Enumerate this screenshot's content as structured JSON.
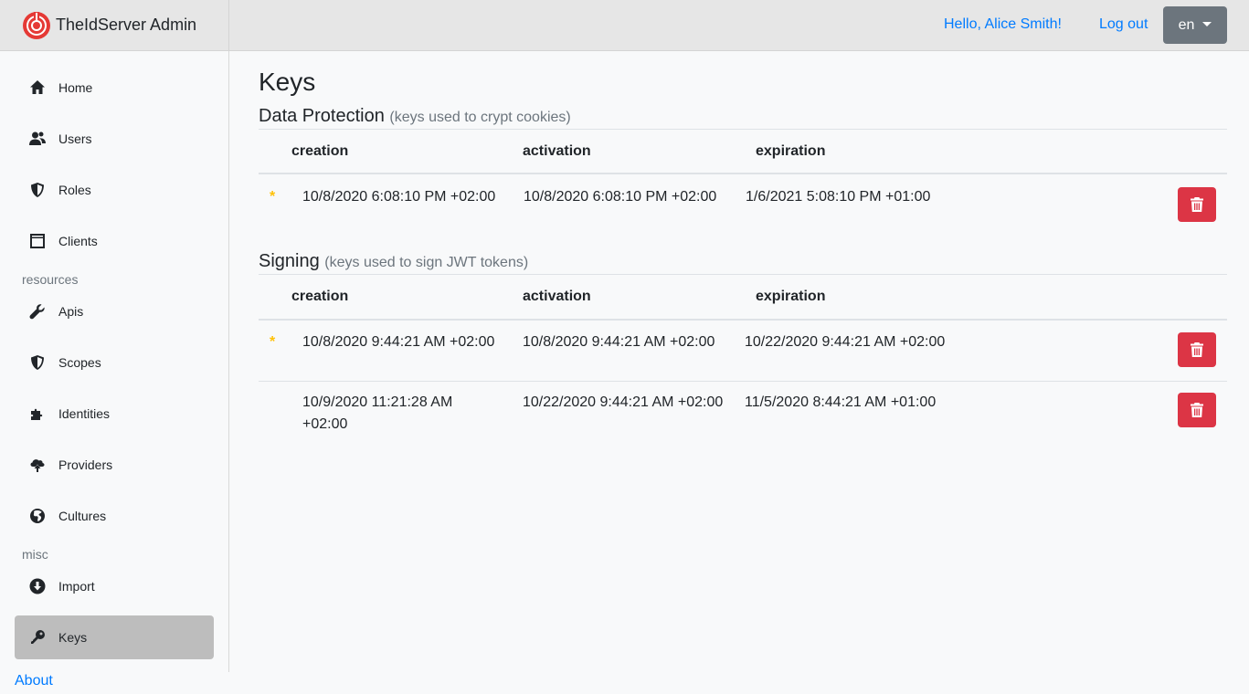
{
  "app": {
    "title": "TheIdServer Admin"
  },
  "header": {
    "greeting": "Hello, Alice Smith!",
    "logout": "Log out",
    "language": "en"
  },
  "sidebar": {
    "items": [
      {
        "label": "Home",
        "icon": "home-icon"
      },
      {
        "label": "Users",
        "icon": "users-icon"
      },
      {
        "label": "Roles",
        "icon": "shield-icon"
      },
      {
        "label": "Clients",
        "icon": "window-icon"
      }
    ],
    "section_resources": "resources",
    "resources": [
      {
        "label": "Apis",
        "icon": "wrench-icon"
      },
      {
        "label": "Scopes",
        "icon": "shield-icon"
      },
      {
        "label": "Identities",
        "icon": "puzzle-icon"
      },
      {
        "label": "Providers",
        "icon": "cloud-upload-icon"
      },
      {
        "label": "Cultures",
        "icon": "globe-icon"
      }
    ],
    "section_misc": "misc",
    "misc": [
      {
        "label": "Import",
        "icon": "download-icon"
      },
      {
        "label": "Keys",
        "icon": "key-icon",
        "active": true
      }
    ],
    "about": "About"
  },
  "main": {
    "title": "Keys",
    "columns": {
      "creation": "creation",
      "activation": "activation",
      "expiration": "expiration"
    },
    "data_protection": {
      "title": "Data Protection",
      "subtitle": "(keys used to crypt cookies)",
      "rows": [
        {
          "current": "*",
          "creation": "10/8/2020 6:08:10 PM +02:00",
          "activation": "10/8/2020 6:08:10 PM +02:00",
          "expiration": "1/6/2021 5:08:10 PM +01:00"
        }
      ]
    },
    "signing": {
      "title": "Signing",
      "subtitle": "(keys used to sign JWT tokens)",
      "rows": [
        {
          "current": "*",
          "creation": "10/8/2020 9:44:21 AM +02:00",
          "activation": "10/8/2020 9:44:21 AM +02:00",
          "expiration": "10/22/2020 9:44:21 AM +02:00"
        },
        {
          "current": "",
          "creation_line1": "10/9/2020 11:21:28 AM",
          "creation_line2": "+02:00",
          "activation": "10/22/2020 9:44:21 AM +02:00",
          "expiration": "11/5/2020 8:44:21 AM +01:00"
        }
      ]
    }
  },
  "colors": {
    "accent": "#007bff",
    "danger": "#dc3545",
    "star": "#ffc107",
    "active_nav": "#bdbdbd"
  }
}
